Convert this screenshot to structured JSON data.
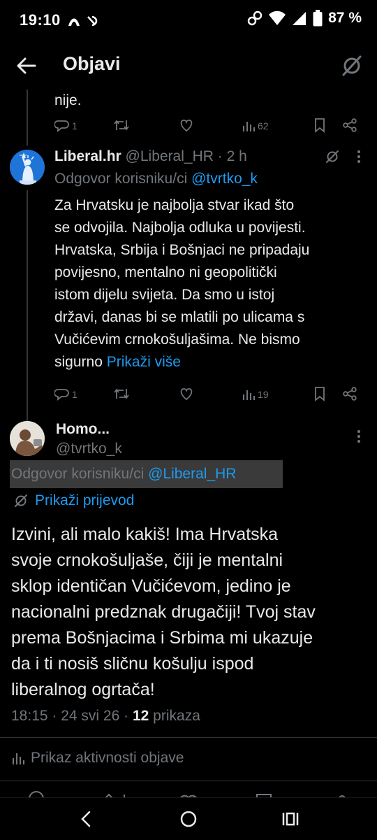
{
  "status_bar": {
    "time": "19:10",
    "battery": "87 %"
  },
  "header": {
    "title": "Objavi"
  },
  "prev_tweet": {
    "text_tail": "nije.",
    "replies": "1",
    "views": "62"
  },
  "reply_tweet": {
    "name": "Liberal.hr",
    "handle": "@Liberal_HR",
    "time": "· 2 h",
    "reply_prefix": "Odgovor korisniku/ci",
    "reply_to": "@tvrtko_k",
    "text_lines": [
      "Za Hrvatsku je najbolja stvar ikad što",
      "se odvojila. Najbolja odluka u povijesti.",
      "Hrvatska, Srbija i Bošnjaci ne pripadaju",
      "povijesno, mentalno ni geopolitički",
      "istom dijelu svijeta. Da smo u istoj",
      "državi, danas bi se mlatili po ulicama s",
      "Vučićevim crnokošuljašima. Ne bismo"
    ],
    "last_line_prefix": "sigurno",
    "show_more": "Prikaži više",
    "replies": "1",
    "views": "19"
  },
  "main_tweet": {
    "name": "Homo...",
    "handle": "@tvrtko_k",
    "reply_prefix": "Odgovor korisniku/ci",
    "reply_to": "@Liberal_HR",
    "translate": "Prikaži prijevod",
    "text_lines": [
      "Izvini, ali malo kakiš! Ima Hrvatska",
      "svoje crnokošuljaše, čiji je mentalni",
      "sklop identičan Vučićevom, jedino je",
      "nacionalni predznak drugačiji! Tvoj stav",
      "prema Bošnjacima i Srbima mi ukazuje",
      "da i ti nosiš sličnu košulju ispod",
      "liberalnog ogrtača!"
    ],
    "time": "18:15",
    "date": "· 24 svi 26 ·",
    "views_count": "12",
    "views_label": "prikaza",
    "activity": "Prikaz aktivnosti objave"
  }
}
